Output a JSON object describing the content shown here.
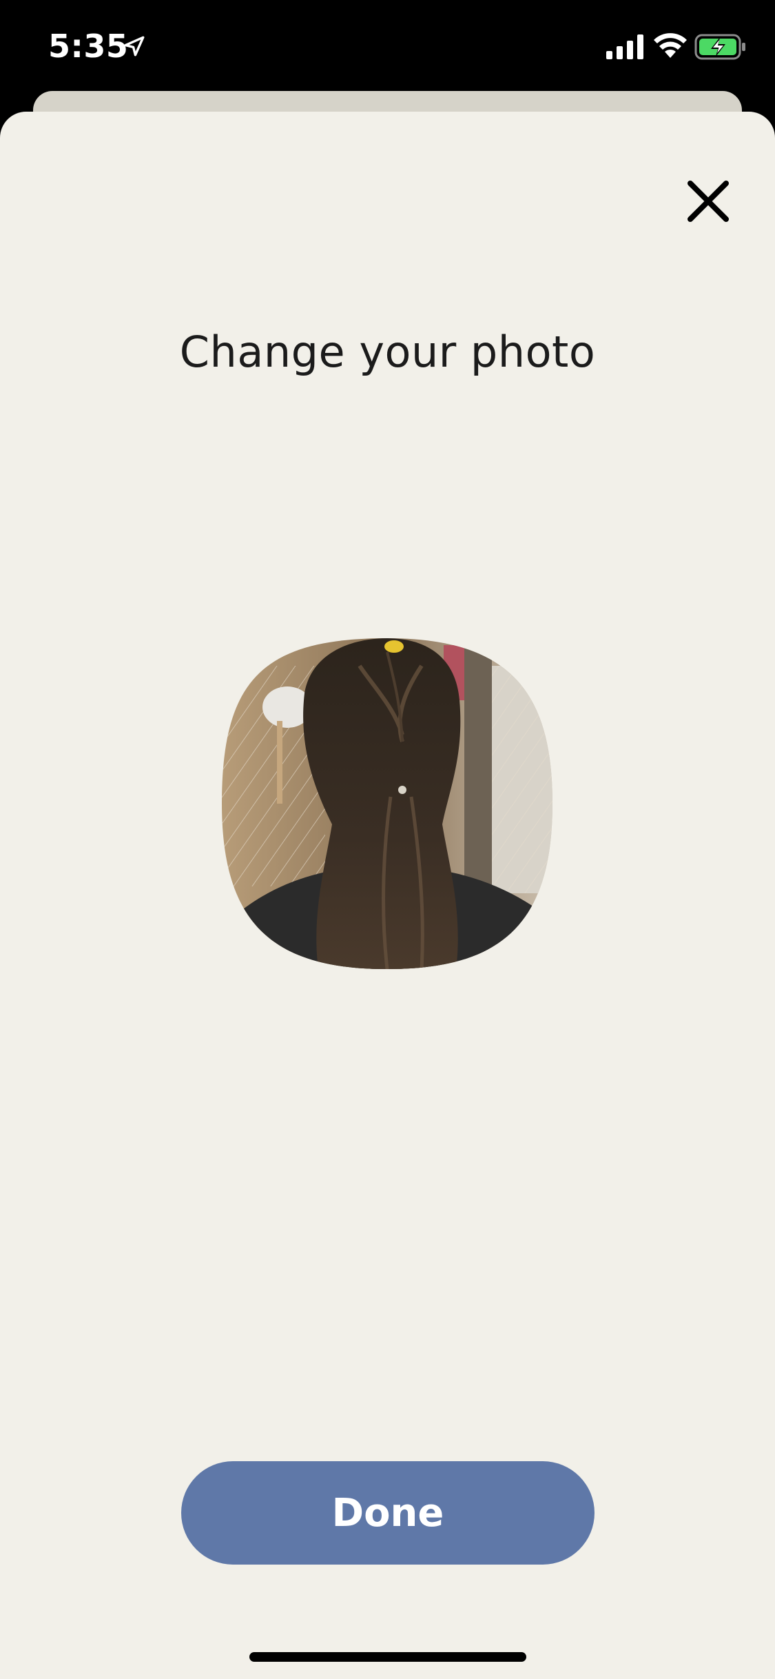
{
  "status_bar": {
    "time": "5:35",
    "icons": [
      "location-arrow-icon",
      "cellular-signal-icon",
      "wifi-icon",
      "battery-charging-icon"
    ],
    "battery_color": "#4cd964"
  },
  "sheet": {
    "background": "#f2f0e9"
  },
  "header": {
    "title": "Change your photo",
    "close_icon": "close-icon"
  },
  "photo": {
    "alt": "Profile photo of a person's braided hair from behind"
  },
  "actions": {
    "done_label": "Done",
    "done_color": "#5f78a8"
  }
}
